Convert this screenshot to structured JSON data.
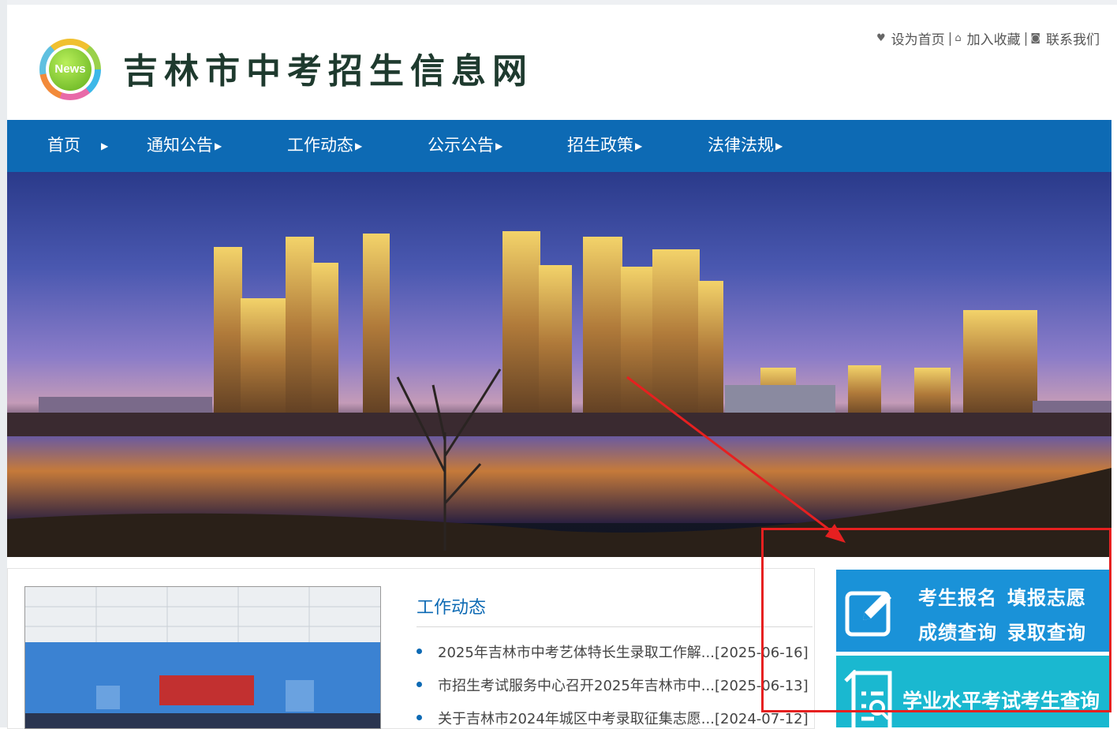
{
  "header": {
    "logo_text": "News",
    "site_title": "吉林市中考招生信息网",
    "top_links": [
      "设为首页",
      "加入收藏",
      "联系我们"
    ]
  },
  "nav": {
    "items": [
      "首页",
      "通知公告",
      "工作动态",
      "公示公告",
      "招生政策",
      "法律法规"
    ]
  },
  "news": {
    "section_title": "工作动态",
    "items": [
      "2025年吉林市中考艺体特长生录取工作解...[2025-06-16]",
      "市招生考试服务中心召开2025年吉林市中...[2025-06-13]",
      "关于吉林市2024年城区中考录取征集志愿...[2024-07-12]"
    ]
  },
  "services": {
    "card1_line1_a": "考生报名",
    "card1_line1_b": "填报志愿",
    "card1_line2_a": "成绩查询",
    "card1_line2_b": "录取查询",
    "card2_label": "学业水平考试考生查询"
  },
  "colors": {
    "nav_bg": "#0d6ab4",
    "card1_bg": "#1a92d8",
    "card2_bg": "#1ab8d0",
    "annotation": "#e62020"
  },
  "icons": {
    "home_page": "heart-icon",
    "favorites": "house-icon",
    "contact": "contact-icon",
    "card1": "edit-icon",
    "card2": "document-icon"
  }
}
